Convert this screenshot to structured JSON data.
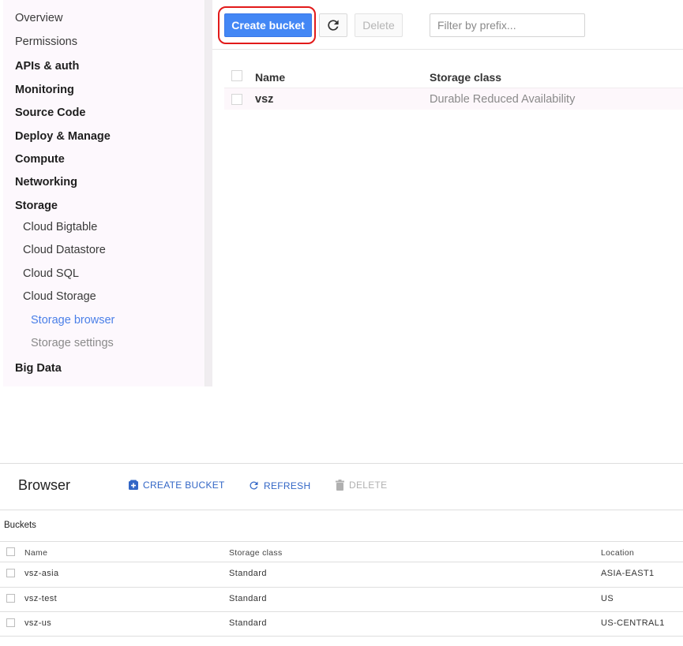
{
  "sidebar": {
    "items": [
      {
        "label": "Overview",
        "level": "plain"
      },
      {
        "label": "Permissions",
        "level": "plain"
      },
      {
        "label": "APIs & auth",
        "level": "bold"
      },
      {
        "label": "Monitoring",
        "level": "bold"
      },
      {
        "label": "Source Code",
        "level": "bold"
      },
      {
        "label": "Deploy & Manage",
        "level": "bold"
      },
      {
        "label": "Compute",
        "level": "bold"
      },
      {
        "label": "Networking",
        "level": "bold"
      },
      {
        "label": "Storage",
        "level": "bold"
      },
      {
        "label": "Cloud Bigtable",
        "level": "sub"
      },
      {
        "label": "Cloud Datastore",
        "level": "sub"
      },
      {
        "label": "Cloud SQL",
        "level": "sub"
      },
      {
        "label": "Cloud Storage",
        "level": "sub"
      },
      {
        "label": "Storage browser",
        "level": "sub2",
        "active": true
      },
      {
        "label": "Storage settings",
        "level": "sub2"
      },
      {
        "label": "Big Data",
        "level": "bold"
      }
    ]
  },
  "top_toolbar": {
    "create_label": "Create bucket",
    "refresh_icon": "refresh-icon",
    "delete_label": "Delete",
    "filter_placeholder": "Filter by prefix..."
  },
  "top_table": {
    "headers": [
      "Name",
      "Storage class"
    ],
    "rows": [
      {
        "name": "vsz",
        "storage_class": "Durable Reduced Availability"
      }
    ]
  },
  "bottom": {
    "title": "Browser",
    "actions": {
      "create": "CREATE BUCKET",
      "refresh": "REFRESH",
      "delete": "DELETE"
    },
    "subtitle": "Buckets",
    "headers": [
      "Name",
      "Storage class",
      "Location"
    ],
    "rows": [
      {
        "name": "vsz-asia",
        "storage_class": "Standard",
        "location": "ASIA-EAST1"
      },
      {
        "name": "vsz-test",
        "storage_class": "Standard",
        "location": "US"
      },
      {
        "name": "vsz-us",
        "storage_class": "Standard",
        "location": "US-CENTRAL1"
      }
    ]
  },
  "colors": {
    "primary": "#4387f5",
    "highlight": "#e21a1a",
    "link": "#3266c6",
    "active_nav": "#4a7fe8"
  }
}
